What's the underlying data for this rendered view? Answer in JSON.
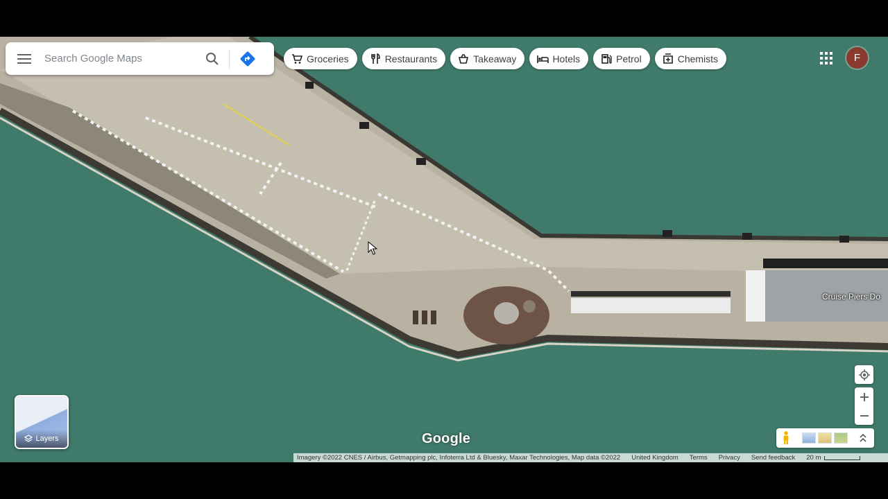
{
  "search": {
    "placeholder": "Search Google Maps"
  },
  "chips": [
    {
      "label": "Groceries",
      "icon": "cart-icon"
    },
    {
      "label": "Restaurants",
      "icon": "cutlery-icon"
    },
    {
      "label": "Takeaway",
      "icon": "takeaway-icon"
    },
    {
      "label": "Hotels",
      "icon": "bed-icon"
    },
    {
      "label": "Petrol",
      "icon": "fuel-icon"
    },
    {
      "label": "Chemists",
      "icon": "pharmacy-icon"
    }
  ],
  "account": {
    "initial": "F",
    "color": "#8b3a2e"
  },
  "map": {
    "place_label": "Cruise Piers Do",
    "water_color": "#3f7a6a"
  },
  "layers": {
    "label": "Layers"
  },
  "logo": "Google",
  "footer": {
    "imagery": "Imagery ©2022 CNES / Airbus, Getmapping plc, Infoterra Ltd & Bluesky, Maxar Technologies, Map data ©2022",
    "region": "United Kingdom",
    "terms": "Terms",
    "privacy": "Privacy",
    "feedback": "Send feedback",
    "scale": "20 m"
  },
  "colors": {
    "directions_blue": "#1a73e8",
    "pegman_yellow": "#f4b400"
  }
}
